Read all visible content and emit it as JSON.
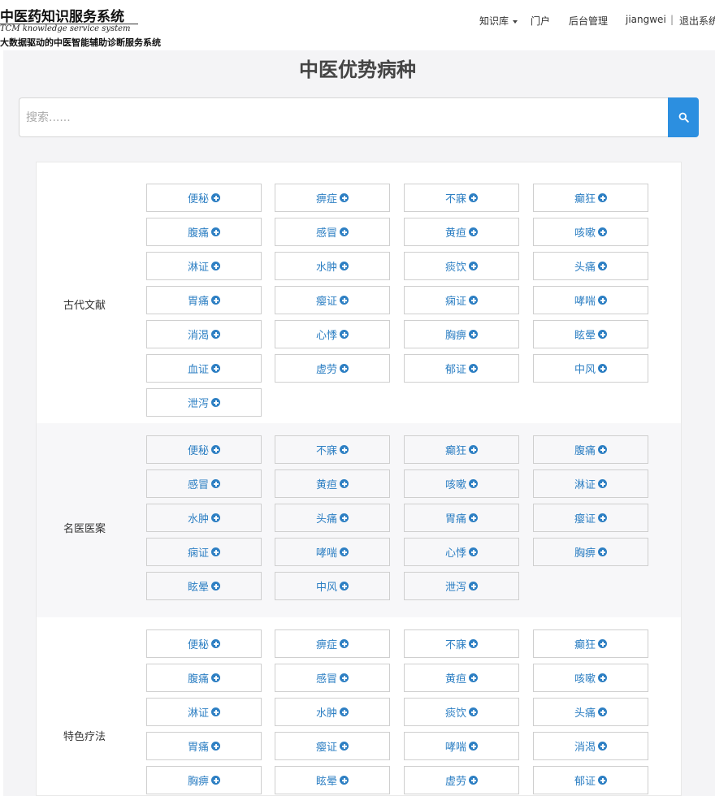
{
  "header": {
    "logo_cn": "中医药知识服务系统",
    "logo_en": "TCM knowledge service system",
    "slogan": "大数据驱动的中医智能辅助诊断服务系统",
    "nav": {
      "knowledge": "知识库",
      "portal": "门户",
      "admin": "后台管理",
      "user": "jiangwei",
      "separator": "|",
      "logout": "退出系统"
    }
  },
  "page_title": "中医优势病种",
  "search": {
    "placeholder": "搜索......"
  },
  "sections": [
    {
      "label": "古代文献",
      "tags": [
        "便秘",
        "痹症",
        "不寐",
        "癫狂",
        "腹痛",
        "感冒",
        "黄疸",
        "咳嗽",
        "淋证",
        "水肿",
        "痰饮",
        "头痛",
        "胃痛",
        "瘿证",
        "痫证",
        "哮喘",
        "消渴",
        "心悸",
        "胸痹",
        "眩晕",
        "血证",
        "虚劳",
        "郁证",
        "中风",
        "泄泻"
      ]
    },
    {
      "label": "名医医案",
      "tags": [
        "便秘",
        "不寐",
        "癫狂",
        "腹痛",
        "感冒",
        "黄疸",
        "咳嗽",
        "淋证",
        "水肿",
        "头痛",
        "胃痛",
        "瘿证",
        "痫证",
        "哮喘",
        "心悸",
        "胸痹",
        "眩晕",
        "中风",
        "泄泻"
      ]
    },
    {
      "label": "特色疗法",
      "tags": [
        "便秘",
        "痹症",
        "不寐",
        "癫狂",
        "腹痛",
        "感冒",
        "黄疸",
        "咳嗽",
        "淋证",
        "水肿",
        "痰饮",
        "头痛",
        "胃痛",
        "瘿证",
        "哮喘",
        "消渴",
        "胸痹",
        "眩晕",
        "虚劳",
        "郁证"
      ]
    }
  ],
  "colors": {
    "accent": "#2c8fe0",
    "tag_text": "#2d7fc3"
  },
  "icons": {
    "search": "search-icon",
    "tag_add": "plus-circle-icon",
    "dropdown": "caret-down-icon"
  }
}
